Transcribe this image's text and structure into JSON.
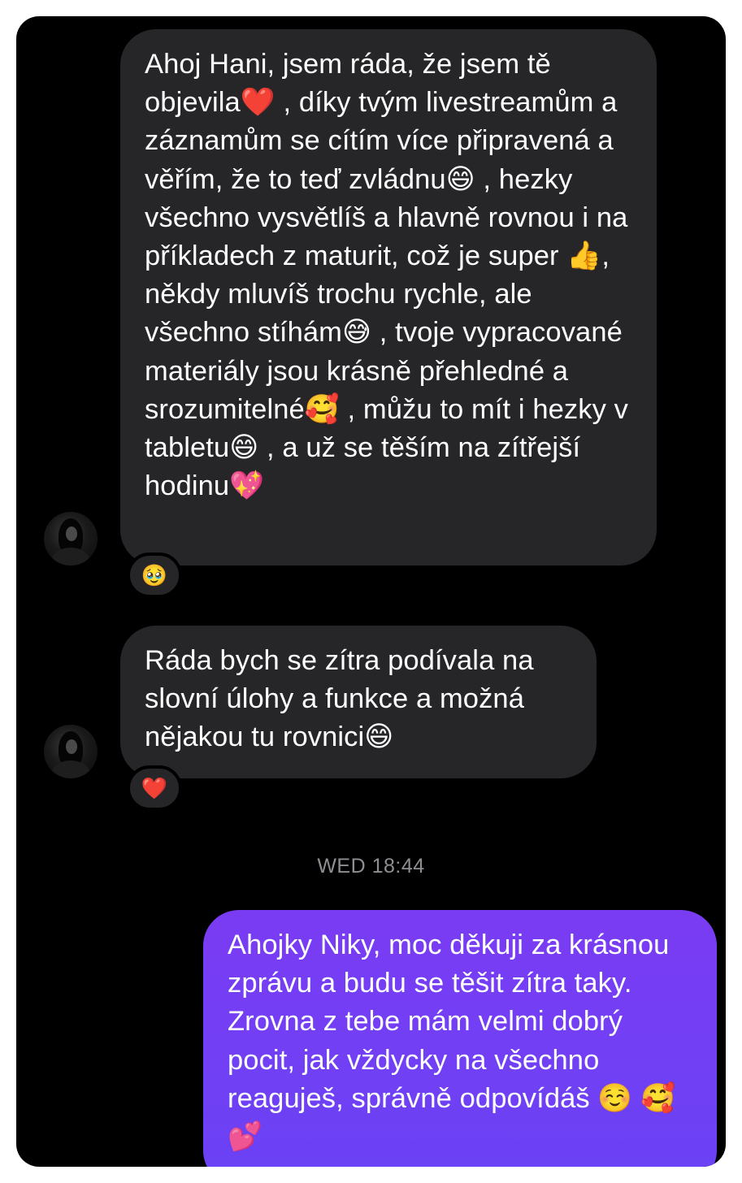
{
  "conversation": {
    "messages": [
      {
        "sender": "them",
        "text": "Ahoj Hani, jsem ráda, že jsem tě objevila❤️ , díky tvým livestreamům a záznamům se cítím více připravená a věřím, že to teď zvládnu😄 , hezky všechno vysvětlíš a hlavně rovnou i na příkladech z maturit, což je super 👍, někdy mluvíš trochu rychle, ale všechno stíhám😅 , tvoje vypracované materiály jsou krásně přehledné a srozumitelné🥰 , můžu to mít i hezky v tabletu😄 , a už se těším na zítřejší hodinu💖",
        "reaction": "🥹"
      },
      {
        "sender": "them",
        "text": "Ráda bych se zítra podívala na slovní úlohy a funkce a možná nějakou tu rovnici😄",
        "reaction": "❤️"
      }
    ],
    "timestamp": "WED 18:44",
    "reply": {
      "sender": "me",
      "text": "Ahojky Niky, moc děkuji za krásnou zprávu a budu se těšit zítra taky. Zrovna z tebe mám velmi dobrý pocit, jak vždycky na všechno reaguješ, správně odpovídáš ☺️ 🥰 💕"
    }
  },
  "colors": {
    "background": "#000000",
    "incoming_bubble": "#262629",
    "outgoing_bubble": "#6f40f4",
    "timestamp_text": "#8e8e93",
    "message_text": "#ffffff"
  },
  "icons": {
    "avatar": "contact-avatar-photo"
  }
}
